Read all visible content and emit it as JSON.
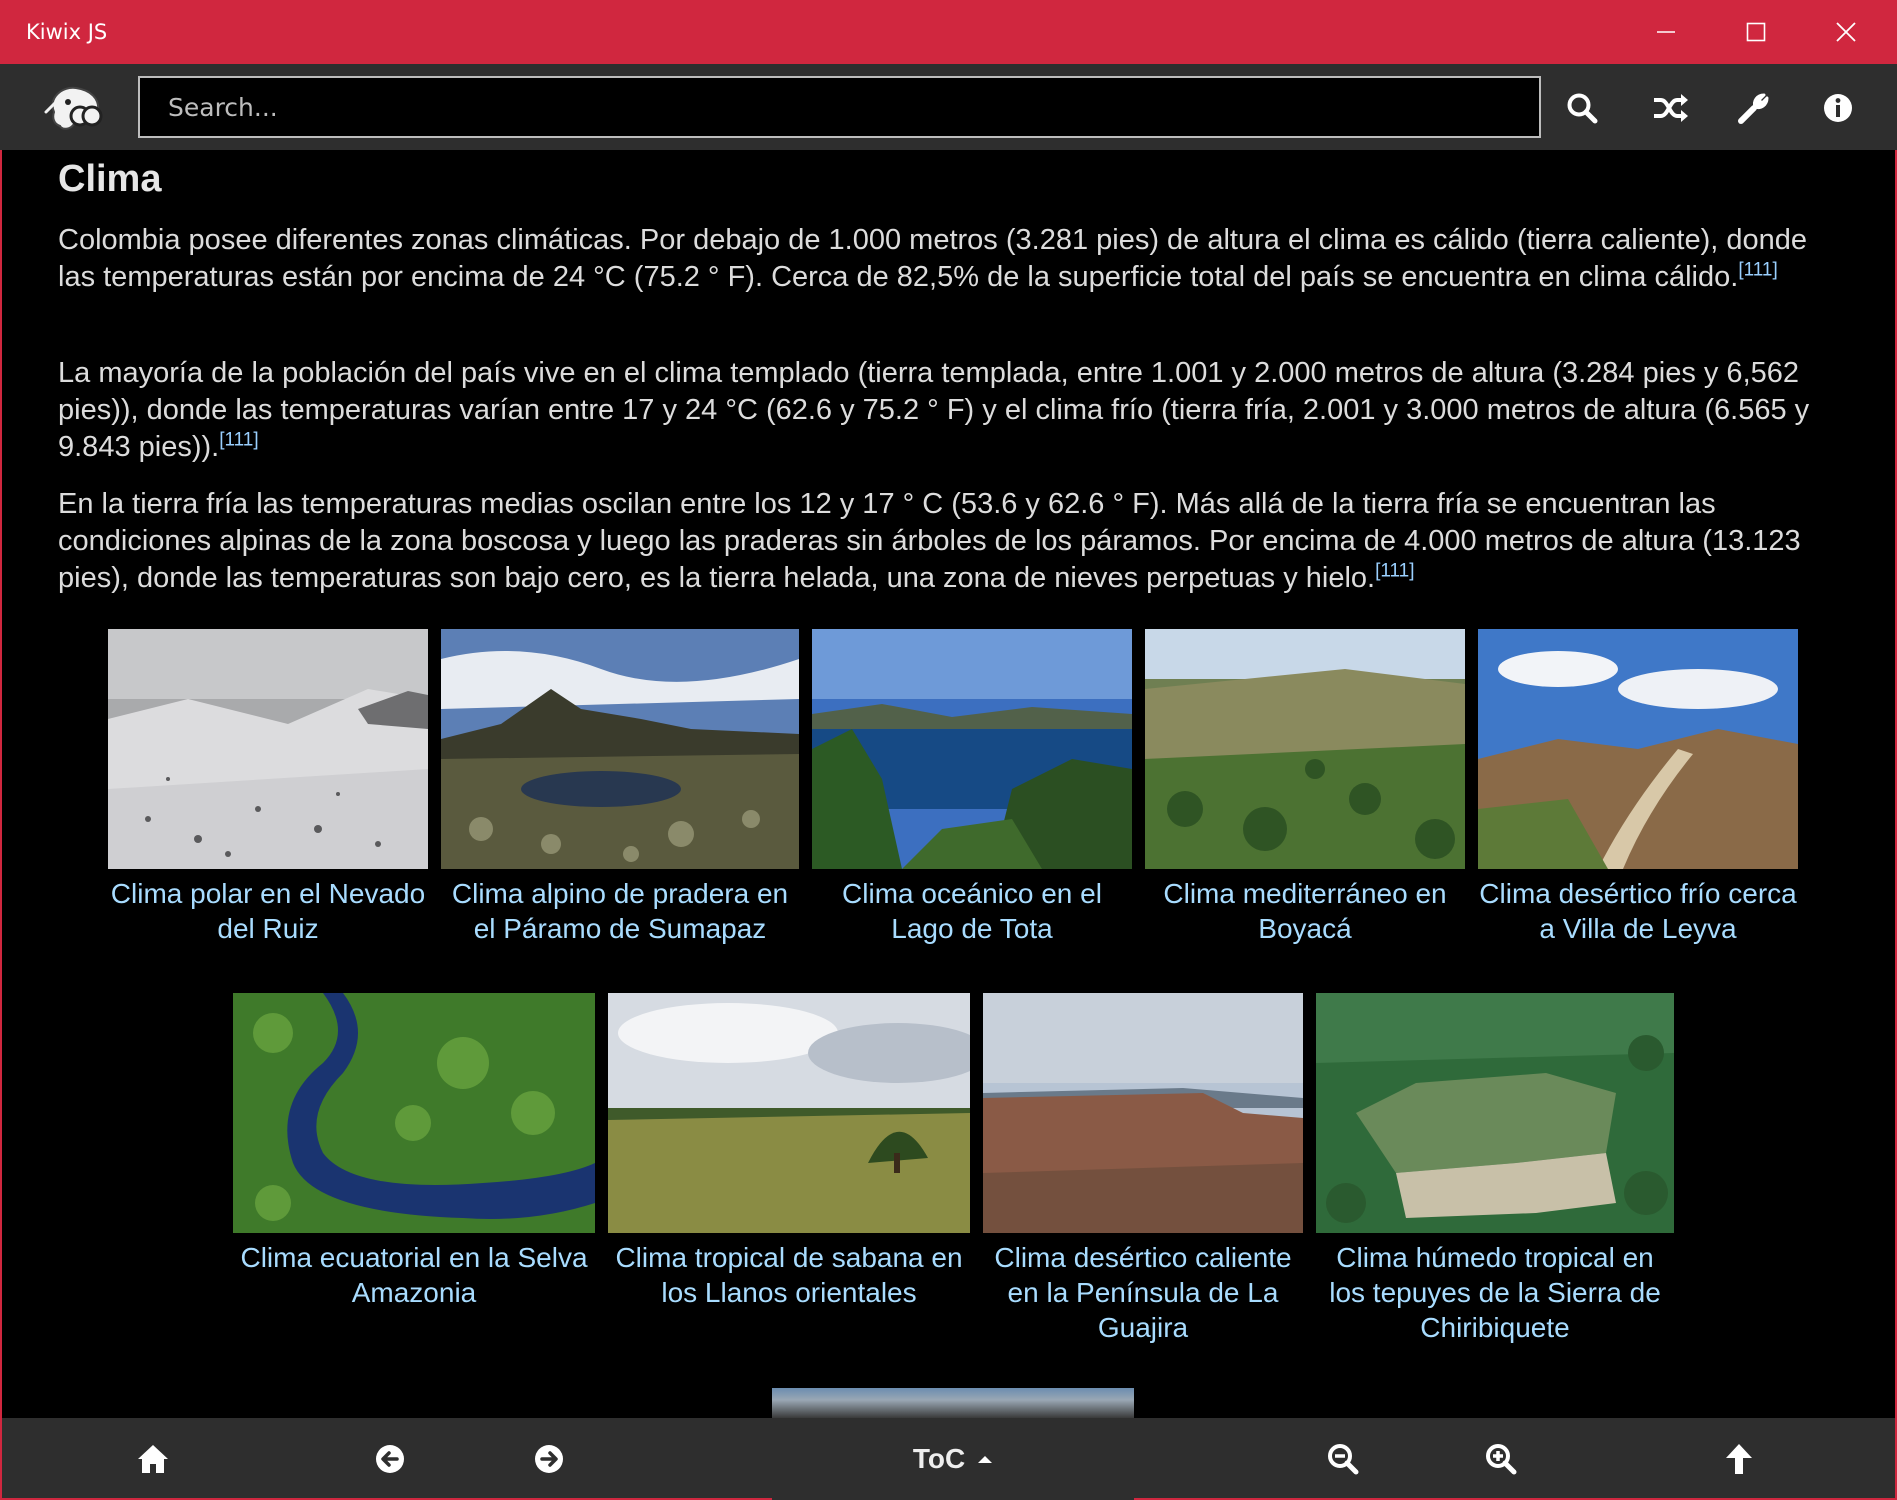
{
  "window": {
    "title": "Kiwix JS"
  },
  "toolbar": {
    "search_placeholder": "Search...",
    "buttons": [
      "search-icon",
      "random-icon",
      "wrench-icon",
      "info-icon"
    ]
  },
  "article": {
    "section_title": "Clima",
    "paragraphs": [
      {
        "text": "Colombia posee diferentes zonas climáticas. Por debajo de 1.000 metros (3.281 pies) de altura el clima es cálido (tierra caliente), donde las temperaturas están por encima de 24 °C (75.2 ° F). Cerca de 82,5% de la superficie total del país se encuentra en clima cálido.",
        "ref": "[111]"
      },
      {
        "text": "La mayoría de la población del país vive en el clima templado (tierra templada, entre 1.001 y 2.000 metros de altura (3.284 pies y 6,562 pies)), donde las temperaturas varían entre 17 y 24 °C (62.6 y 75.2 ° F) y el clima frío (tierra fría, 2.001 y 3.000 metros de altura (6.565 y 9.843 pies)).",
        "ref": "[111]"
      },
      {
        "text": "En la tierra fría las temperaturas medias oscilan entre los 12 y 17 ° C (53.6 y 62.6 ° F). Más allá de la tierra fría se encuentran las condiciones alpinas de la zona boscosa y luego las praderas sin árboles de los páramos. Por encima de 4.000 metros de altura (13.123 pies), donde las temperaturas son bajo cero, es la tierra helada, una zona de nieves perpetuas y hielo.",
        "ref": "[111]"
      }
    ],
    "gallery": [
      {
        "caption": "Clima polar en el Nevado del Ruiz"
      },
      {
        "caption": "Clima alpino de pradera en el Páramo de Sumapaz"
      },
      {
        "caption": "Clima oceánico en el Lago de Tota"
      },
      {
        "caption": "Clima mediterráneo en Boyacá"
      },
      {
        "caption": "Clima desértico frío cerca a Villa de Leyva"
      },
      {
        "caption": "Clima ecuatorial en la Selva Amazonia"
      },
      {
        "caption": "Clima tropical de sabana en los Llanos orientales"
      },
      {
        "caption": "Clima desértico caliente en la Península de La Guajira"
      },
      {
        "caption": "Clima húmedo tropical en los tepuyes de la Sierra de Chiribiquete"
      }
    ]
  },
  "bottombar": {
    "toc_label": "ToC",
    "buttons": [
      "home-icon",
      "back-icon",
      "forward-icon",
      "zoom-out-icon",
      "zoom-in-icon",
      "scroll-top-icon"
    ]
  },
  "colors": {
    "titlebar": "#d0273f",
    "toolbar": "#2e2e2e",
    "link": "#a8dcff"
  }
}
